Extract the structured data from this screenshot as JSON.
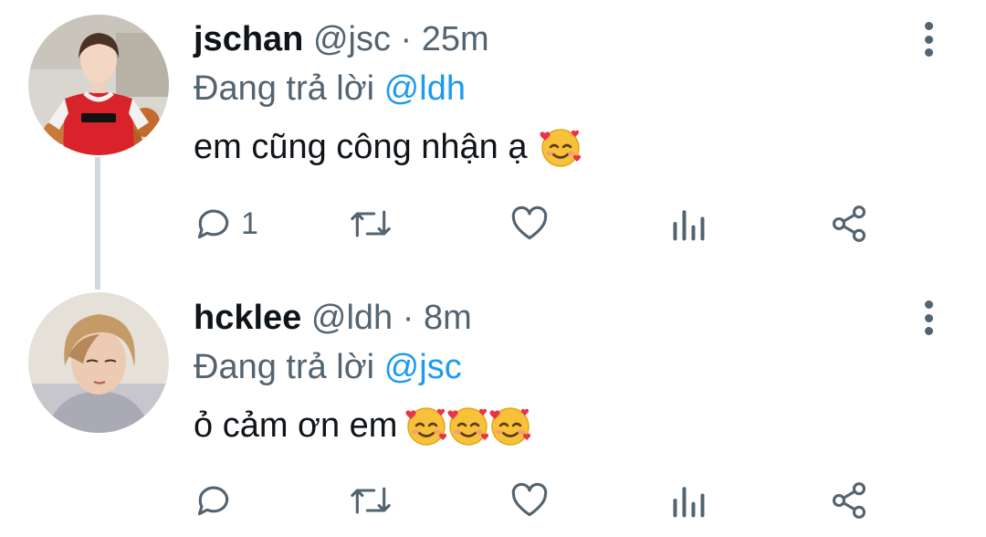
{
  "tweets": [
    {
      "display_name": "jschan",
      "handle": "@jsc",
      "separator": "·",
      "time": "25m",
      "reply_prefix": "Đang trả lời",
      "reply_to": "@ldh",
      "text": "em cũng công nhận ạ",
      "emoji_count": 1,
      "reply_count": "1"
    },
    {
      "display_name": "hcklee",
      "handle": "@ldh",
      "separator": "·",
      "time": "8m",
      "reply_prefix": "Đang trả lời",
      "reply_to": "@jsc",
      "text": "ỏ cảm ơn em",
      "emoji_count": 3,
      "reply_count": ""
    }
  ],
  "icons": {
    "reply": "reply-icon",
    "retweet": "retweet-icon",
    "like": "heart-icon",
    "stats": "analytics-icon",
    "share": "share-icon",
    "more": "more-vertical-icon",
    "emoji": "smiling-face-with-hearts-emoji"
  },
  "colors": {
    "text_primary": "#0f1419",
    "text_secondary": "#536471",
    "mention": "#1d9bf0",
    "icon": "#536471",
    "thread_line": "#cfd9de"
  }
}
